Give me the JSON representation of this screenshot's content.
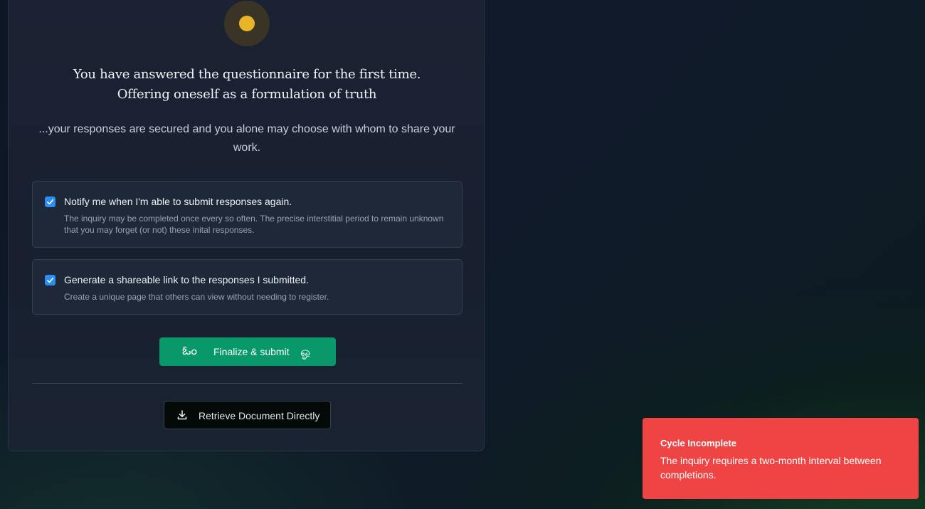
{
  "card": {
    "headline_line1": "You have answered the questionnaire for the first time.",
    "headline_line2": "Offering oneself as a formulation of truth",
    "subtitle": "...your responses are secured and you alone may choose with whom to share your work."
  },
  "options": [
    {
      "checked": true,
      "title": "Notify me when I'm able to submit responses again.",
      "description": "The inquiry may be completed once every so often. The precise interstitial period to remain unknown that you may forget (or not) these inital responses."
    },
    {
      "checked": true,
      "title": "Generate a shareable link to the responses I submitted.",
      "description": "Create a unique page that others can view without needing to register."
    }
  ],
  "actions": {
    "submit_label": "Finalize & submit",
    "submit_glyph_left": "ఓం",
    "submit_glyph_right": "ஓ",
    "retrieve_label": "Retrieve Document Directly",
    "retrieve_icon": "download-icon"
  },
  "toast": {
    "title": "Cycle Incomplete",
    "message": "The inquiry requires a two-month interval between completions."
  },
  "colors": {
    "accent_green": "#089869",
    "checkbox_blue": "#2b8ef0",
    "toast_red": "#ef4444",
    "emblem_gold": "#e8b429"
  }
}
